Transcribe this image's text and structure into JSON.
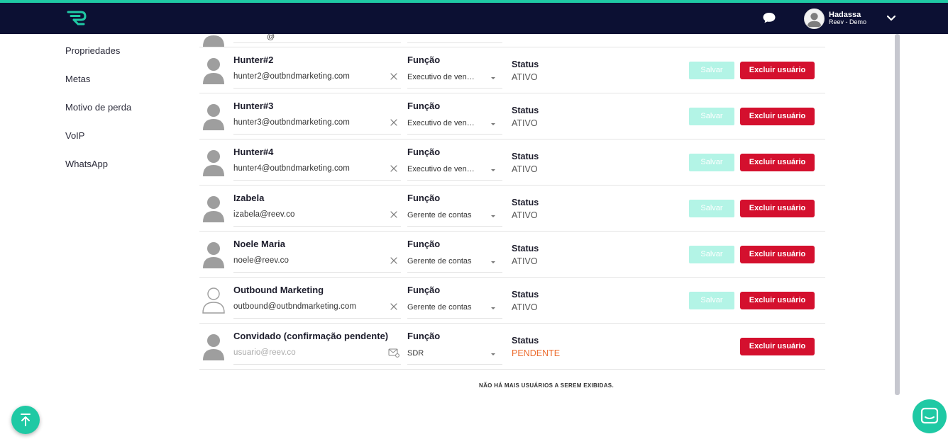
{
  "header": {
    "user_name": "Hadassa",
    "user_company": "Reev - Demo",
    "accent_color": "#1fc9a4",
    "bar_color": "#0c1033"
  },
  "sidebar": {
    "items": [
      {
        "label": "Propriedades"
      },
      {
        "label": "Metas"
      },
      {
        "label": "Motivo de perda"
      },
      {
        "label": "VoIP"
      },
      {
        "label": "WhatsApp"
      }
    ]
  },
  "partial_row": {
    "email_fragment": "@"
  },
  "users": [
    {
      "name": "Hunter#2",
      "email": "hunter2@outbndmarketing.com",
      "function_label": "Função",
      "function_value": "Executivo de vendas",
      "status_label": "Status",
      "status_value": "ATIVO",
      "save_label": "Salvar",
      "delete_label": "Excluir usuário"
    },
    {
      "name": "Hunter#3",
      "email": "hunter3@outbndmarketing.com",
      "function_label": "Função",
      "function_value": "Executivo de vendas",
      "status_label": "Status",
      "status_value": "ATIVO",
      "save_label": "Salvar",
      "delete_label": "Excluir usuário"
    },
    {
      "name": "Hunter#4",
      "email": "hunter4@outbndmarketing.com",
      "function_label": "Função",
      "function_value": "Executivo de vendas",
      "status_label": "Status",
      "status_value": "ATIVO",
      "save_label": "Salvar",
      "delete_label": "Excluir usuário"
    },
    {
      "name": "Izabela",
      "email": "izabela@reev.co",
      "function_label": "Função",
      "function_value": "Gerente de contas",
      "status_label": "Status",
      "status_value": "ATIVO",
      "save_label": "Salvar",
      "delete_label": "Excluir usuário"
    },
    {
      "name": "Noele Maria",
      "email": "noele@reev.co",
      "function_label": "Função",
      "function_value": "Gerente de contas",
      "status_label": "Status",
      "status_value": "ATIVO",
      "save_label": "Salvar",
      "delete_label": "Excluir usuário"
    },
    {
      "name": "Outbound Marketing",
      "email": "outbound@outbndmarketing.com",
      "function_label": "Função",
      "function_value": "Gerente de contas",
      "status_label": "Status",
      "status_value": "ATIVO",
      "save_label": "Salvar",
      "delete_label": "Excluir usuário"
    }
  ],
  "invited": {
    "name": "Convidado (confirmação pendente)",
    "email_placeholder": "usuario@reev.co",
    "function_label": "Função",
    "function_value": "SDR",
    "status_label": "Status",
    "status_value": "PENDENTE",
    "delete_label": "Excluir usuário",
    "pending_color": "#ec6b2d"
  },
  "footer": {
    "end_message": "NÃO HÁ MAIS USUÁRIOS A SEREM EXIBIDAS."
  }
}
